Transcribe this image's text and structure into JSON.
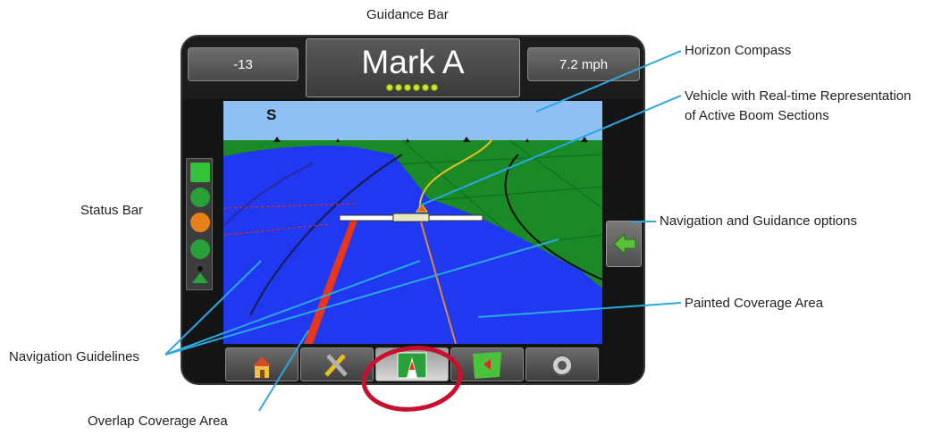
{
  "callouts": {
    "guidance_bar": "Guidance Bar",
    "horizon_compass": "Horizon Compass",
    "vehicle_line1": "Vehicle with Real-time Representation",
    "vehicle_line2": "of Active Boom Sections",
    "status_bar": "Status Bar",
    "nav_options": "Navigation and Guidance options",
    "painted_area": "Painted Coverage Area",
    "nav_guidelines": "Navigation Guidelines",
    "overlap_area": "Overlap Coverage Area"
  },
  "guidance_bar": {
    "cross_track": "-13",
    "title": "Mark A",
    "speed": "7.2 mph"
  },
  "compass": {
    "heading": "S"
  },
  "status_icons": [
    "boom-section-icon",
    "steering-icon",
    "gps-receiver-icon",
    "tilt-icon",
    "vehicle-icon"
  ],
  "bottom_tabs": [
    "home-icon",
    "tools-icon",
    "guidance-icon",
    "mapping-icon",
    "gauge-icon"
  ],
  "colors": {
    "sky": "#8fc0f4",
    "field_green": "#1a8a26",
    "coverage_blue": "#1f38f0",
    "overlap_red": "#e8361a",
    "callout_line": "#2aa9e0",
    "highlight_ring": "#c8102e"
  }
}
